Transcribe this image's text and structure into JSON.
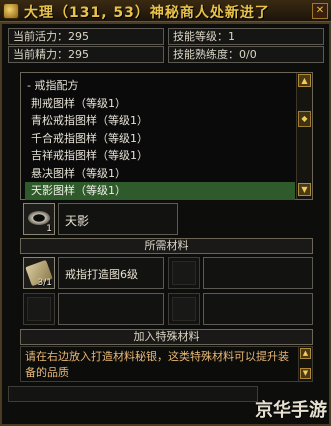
{
  "window": {
    "title": "大理（131, 53）神秘商人处新进了",
    "close_label": "✕"
  },
  "stats": {
    "current_vitality": "当前活力：295",
    "skill_level": "技能等级：1",
    "current_energy": "当前精力：295",
    "skill_proficiency": "技能熟练度：0/0"
  },
  "recipes": {
    "header": "- 戒指配方",
    "items": [
      "荆戒图样（等级1）",
      "青松戒指图样（等级1）",
      "千合戒指图样（等级1）",
      "吉祥戒指图样（等级1）",
      "悬决图样（等级1）",
      "天影图样（等级1）"
    ],
    "selected_index": 5
  },
  "product": {
    "name": "天影",
    "quantity": "1"
  },
  "materials": {
    "label": "所需材料",
    "item_name": "戒指打造图6级",
    "item_quantity": "3/1"
  },
  "special": {
    "label": "加入特殊材料",
    "description": "请在右边放入打造材料秘银，这类特殊材料可以提升装备的品质"
  },
  "watermark": "京华手游",
  "colors": {
    "title": "#e8c24a",
    "selected_row": "#2f5a2c",
    "description_text": "#e8b878"
  }
}
